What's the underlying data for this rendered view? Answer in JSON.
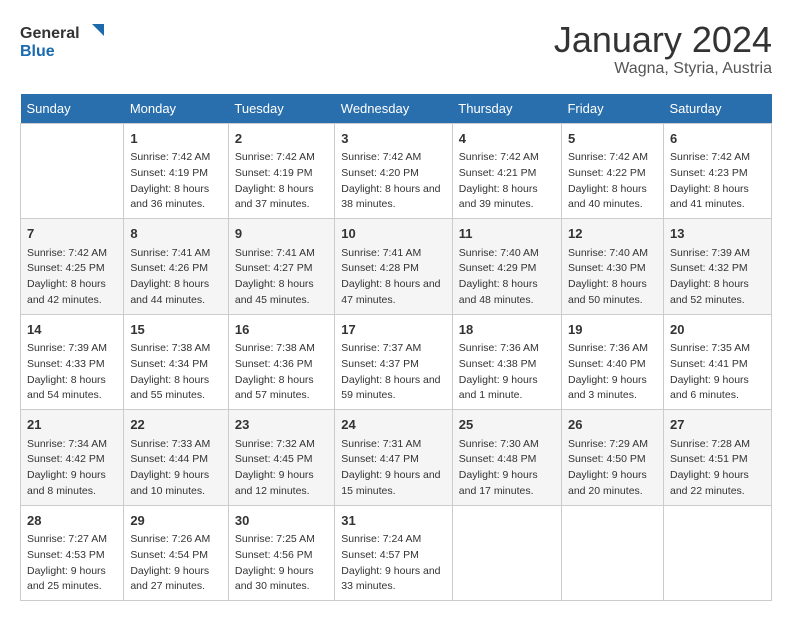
{
  "logo": {
    "general": "General",
    "blue": "Blue"
  },
  "title": "January 2024",
  "subtitle": "Wagna, Styria, Austria",
  "days_header": [
    "Sunday",
    "Monday",
    "Tuesday",
    "Wednesday",
    "Thursday",
    "Friday",
    "Saturday"
  ],
  "weeks": [
    [
      {
        "day": "",
        "sunrise": "",
        "sunset": "",
        "daylight": ""
      },
      {
        "day": "1",
        "sunrise": "Sunrise: 7:42 AM",
        "sunset": "Sunset: 4:19 PM",
        "daylight": "Daylight: 8 hours and 36 minutes."
      },
      {
        "day": "2",
        "sunrise": "Sunrise: 7:42 AM",
        "sunset": "Sunset: 4:19 PM",
        "daylight": "Daylight: 8 hours and 37 minutes."
      },
      {
        "day": "3",
        "sunrise": "Sunrise: 7:42 AM",
        "sunset": "Sunset: 4:20 PM",
        "daylight": "Daylight: 8 hours and 38 minutes."
      },
      {
        "day": "4",
        "sunrise": "Sunrise: 7:42 AM",
        "sunset": "Sunset: 4:21 PM",
        "daylight": "Daylight: 8 hours and 39 minutes."
      },
      {
        "day": "5",
        "sunrise": "Sunrise: 7:42 AM",
        "sunset": "Sunset: 4:22 PM",
        "daylight": "Daylight: 8 hours and 40 minutes."
      },
      {
        "day": "6",
        "sunrise": "Sunrise: 7:42 AM",
        "sunset": "Sunset: 4:23 PM",
        "daylight": "Daylight: 8 hours and 41 minutes."
      }
    ],
    [
      {
        "day": "7",
        "sunrise": "Sunrise: 7:42 AM",
        "sunset": "Sunset: 4:25 PM",
        "daylight": "Daylight: 8 hours and 42 minutes."
      },
      {
        "day": "8",
        "sunrise": "Sunrise: 7:41 AM",
        "sunset": "Sunset: 4:26 PM",
        "daylight": "Daylight: 8 hours and 44 minutes."
      },
      {
        "day": "9",
        "sunrise": "Sunrise: 7:41 AM",
        "sunset": "Sunset: 4:27 PM",
        "daylight": "Daylight: 8 hours and 45 minutes."
      },
      {
        "day": "10",
        "sunrise": "Sunrise: 7:41 AM",
        "sunset": "Sunset: 4:28 PM",
        "daylight": "Daylight: 8 hours and 47 minutes."
      },
      {
        "day": "11",
        "sunrise": "Sunrise: 7:40 AM",
        "sunset": "Sunset: 4:29 PM",
        "daylight": "Daylight: 8 hours and 48 minutes."
      },
      {
        "day": "12",
        "sunrise": "Sunrise: 7:40 AM",
        "sunset": "Sunset: 4:30 PM",
        "daylight": "Daylight: 8 hours and 50 minutes."
      },
      {
        "day": "13",
        "sunrise": "Sunrise: 7:39 AM",
        "sunset": "Sunset: 4:32 PM",
        "daylight": "Daylight: 8 hours and 52 minutes."
      }
    ],
    [
      {
        "day": "14",
        "sunrise": "Sunrise: 7:39 AM",
        "sunset": "Sunset: 4:33 PM",
        "daylight": "Daylight: 8 hours and 54 minutes."
      },
      {
        "day": "15",
        "sunrise": "Sunrise: 7:38 AM",
        "sunset": "Sunset: 4:34 PM",
        "daylight": "Daylight: 8 hours and 55 minutes."
      },
      {
        "day": "16",
        "sunrise": "Sunrise: 7:38 AM",
        "sunset": "Sunset: 4:36 PM",
        "daylight": "Daylight: 8 hours and 57 minutes."
      },
      {
        "day": "17",
        "sunrise": "Sunrise: 7:37 AM",
        "sunset": "Sunset: 4:37 PM",
        "daylight": "Daylight: 8 hours and 59 minutes."
      },
      {
        "day": "18",
        "sunrise": "Sunrise: 7:36 AM",
        "sunset": "Sunset: 4:38 PM",
        "daylight": "Daylight: 9 hours and 1 minute."
      },
      {
        "day": "19",
        "sunrise": "Sunrise: 7:36 AM",
        "sunset": "Sunset: 4:40 PM",
        "daylight": "Daylight: 9 hours and 3 minutes."
      },
      {
        "day": "20",
        "sunrise": "Sunrise: 7:35 AM",
        "sunset": "Sunset: 4:41 PM",
        "daylight": "Daylight: 9 hours and 6 minutes."
      }
    ],
    [
      {
        "day": "21",
        "sunrise": "Sunrise: 7:34 AM",
        "sunset": "Sunset: 4:42 PM",
        "daylight": "Daylight: 9 hours and 8 minutes."
      },
      {
        "day": "22",
        "sunrise": "Sunrise: 7:33 AM",
        "sunset": "Sunset: 4:44 PM",
        "daylight": "Daylight: 9 hours and 10 minutes."
      },
      {
        "day": "23",
        "sunrise": "Sunrise: 7:32 AM",
        "sunset": "Sunset: 4:45 PM",
        "daylight": "Daylight: 9 hours and 12 minutes."
      },
      {
        "day": "24",
        "sunrise": "Sunrise: 7:31 AM",
        "sunset": "Sunset: 4:47 PM",
        "daylight": "Daylight: 9 hours and 15 minutes."
      },
      {
        "day": "25",
        "sunrise": "Sunrise: 7:30 AM",
        "sunset": "Sunset: 4:48 PM",
        "daylight": "Daylight: 9 hours and 17 minutes."
      },
      {
        "day": "26",
        "sunrise": "Sunrise: 7:29 AM",
        "sunset": "Sunset: 4:50 PM",
        "daylight": "Daylight: 9 hours and 20 minutes."
      },
      {
        "day": "27",
        "sunrise": "Sunrise: 7:28 AM",
        "sunset": "Sunset: 4:51 PM",
        "daylight": "Daylight: 9 hours and 22 minutes."
      }
    ],
    [
      {
        "day": "28",
        "sunrise": "Sunrise: 7:27 AM",
        "sunset": "Sunset: 4:53 PM",
        "daylight": "Daylight: 9 hours and 25 minutes."
      },
      {
        "day": "29",
        "sunrise": "Sunrise: 7:26 AM",
        "sunset": "Sunset: 4:54 PM",
        "daylight": "Daylight: 9 hours and 27 minutes."
      },
      {
        "day": "30",
        "sunrise": "Sunrise: 7:25 AM",
        "sunset": "Sunset: 4:56 PM",
        "daylight": "Daylight: 9 hours and 30 minutes."
      },
      {
        "day": "31",
        "sunrise": "Sunrise: 7:24 AM",
        "sunset": "Sunset: 4:57 PM",
        "daylight": "Daylight: 9 hours and 33 minutes."
      },
      {
        "day": "",
        "sunrise": "",
        "sunset": "",
        "daylight": ""
      },
      {
        "day": "",
        "sunrise": "",
        "sunset": "",
        "daylight": ""
      },
      {
        "day": "",
        "sunrise": "",
        "sunset": "",
        "daylight": ""
      }
    ]
  ]
}
